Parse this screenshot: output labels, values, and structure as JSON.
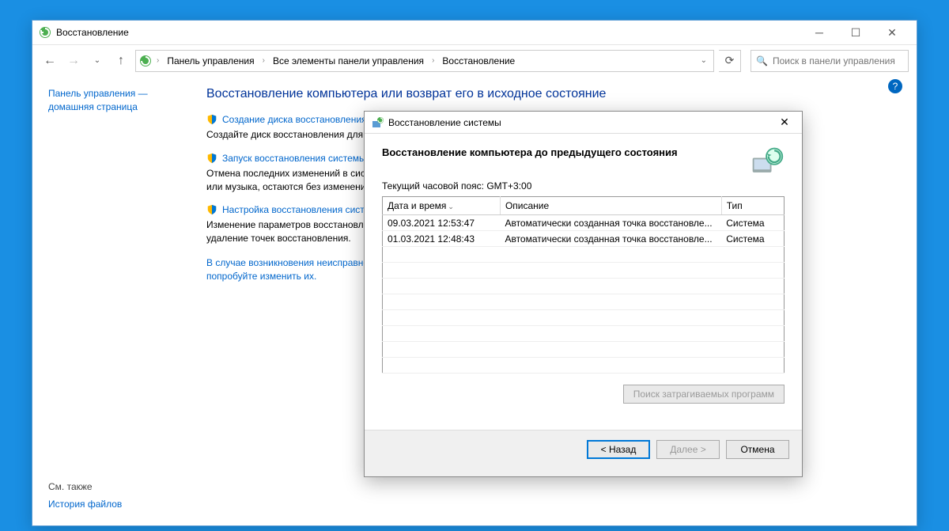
{
  "parent": {
    "title": "Восстановление",
    "breadcrumb": [
      "Панель управления",
      "Все элементы панели управления",
      "Восстановление"
    ],
    "search_placeholder": "Поиск в панели управления"
  },
  "sidebar": {
    "home_link_l1": "Панель управления —",
    "home_link_l2": "домашняя страница"
  },
  "main": {
    "heading": "Восстановление компьютера или возврат его в исходное состояние",
    "items": [
      {
        "title": "Создание диска восстановления",
        "desc": "Создайте диск восстановления для"
      },
      {
        "title": "Запуск восстановления системы",
        "desc": "Отмена последних изменений в системе, однако такие файлы, как документы, изображения или музыка, остаются без изменений."
      },
      {
        "title": "Настройка восстановления системы",
        "desc": "Изменение параметров восстановления, управление дисковым пространством и создание/удаление точек восстановления."
      }
    ],
    "trouble": "В случае возникновения неисправностей в работе компьютера перейдите в параметры и попробуйте изменить их."
  },
  "also": {
    "heading": "См. также",
    "link": "История файлов"
  },
  "dialog": {
    "title": "Восстановление системы",
    "heading": "Восстановление компьютера до предыдущего состояния",
    "tz": "Текущий часовой пояс: GMT+3:00",
    "cols": {
      "date": "Дата и время",
      "desc": "Описание",
      "type": "Тип"
    },
    "rows": [
      {
        "date": "09.03.2021 12:53:47",
        "desc": "Автоматически созданная точка восстановле...",
        "type": "Система"
      },
      {
        "date": "01.03.2021 12:48:43",
        "desc": "Автоматически созданная точка восстановле...",
        "type": "Система"
      }
    ],
    "scan_btn": "Поиск затрагиваемых программ",
    "back": "< Назад",
    "next": "Далее >",
    "cancel": "Отмена"
  }
}
